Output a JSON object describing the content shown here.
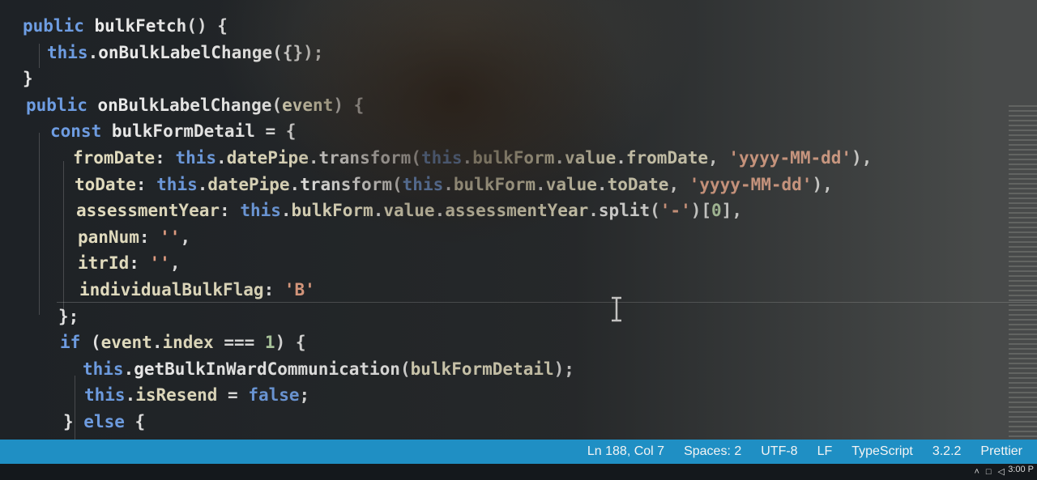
{
  "editor": {
    "lines": [
      [
        {
          "c": "kw",
          "t": "public "
        },
        {
          "c": "fn",
          "t": "bulkFetch"
        },
        {
          "c": "pun",
          "t": "() {"
        }
      ],
      [
        {
          "c": "kw",
          "t": "this"
        },
        {
          "c": "pun",
          "t": "."
        },
        {
          "c": "fn",
          "t": "onBulkLabelChange"
        },
        {
          "c": "pun",
          "t": "({});"
        }
      ],
      [
        {
          "c": "pun",
          "t": "}"
        }
      ],
      [
        {
          "c": "kw",
          "t": "public "
        },
        {
          "c": "fn",
          "t": "onBulkLabelChange"
        },
        {
          "c": "pun",
          "t": "("
        },
        {
          "c": "prop",
          "t": "event"
        },
        {
          "c": "pun",
          "t": ") {"
        }
      ],
      [
        {
          "c": "kw",
          "t": "const "
        },
        {
          "c": "fn",
          "t": "bulkFormDetail"
        },
        {
          "c": "pun",
          "t": " = {"
        }
      ],
      [
        {
          "c": "prop",
          "t": "fromDate"
        },
        {
          "c": "pun",
          "t": ": "
        },
        {
          "c": "kw",
          "t": "this"
        },
        {
          "c": "pun",
          "t": "."
        },
        {
          "c": "prop",
          "t": "datePipe"
        },
        {
          "c": "pun",
          "t": "."
        },
        {
          "c": "fn",
          "t": "transform"
        },
        {
          "c": "pun",
          "t": "("
        },
        {
          "c": "kw",
          "t": "this"
        },
        {
          "c": "pun",
          "t": "."
        },
        {
          "c": "prop",
          "t": "bulkForm"
        },
        {
          "c": "pun",
          "t": "."
        },
        {
          "c": "prop",
          "t": "value"
        },
        {
          "c": "pun",
          "t": "."
        },
        {
          "c": "prop",
          "t": "fromDate"
        },
        {
          "c": "pun",
          "t": ", "
        },
        {
          "c": "str",
          "t": "'yyyy-MM-dd'"
        },
        {
          "c": "pun",
          "t": "),"
        }
      ],
      [
        {
          "c": "prop",
          "t": "toDate"
        },
        {
          "c": "pun",
          "t": ": "
        },
        {
          "c": "kw",
          "t": "this"
        },
        {
          "c": "pun",
          "t": "."
        },
        {
          "c": "prop",
          "t": "datePipe"
        },
        {
          "c": "pun",
          "t": "."
        },
        {
          "c": "fn",
          "t": "transform"
        },
        {
          "c": "pun",
          "t": "("
        },
        {
          "c": "kw",
          "t": "this"
        },
        {
          "c": "pun",
          "t": "."
        },
        {
          "c": "prop",
          "t": "bulkForm"
        },
        {
          "c": "pun",
          "t": "."
        },
        {
          "c": "prop",
          "t": "value"
        },
        {
          "c": "pun",
          "t": "."
        },
        {
          "c": "prop",
          "t": "toDate"
        },
        {
          "c": "pun",
          "t": ", "
        },
        {
          "c": "str",
          "t": "'yyyy-MM-dd'"
        },
        {
          "c": "pun",
          "t": "),"
        }
      ],
      [
        {
          "c": "prop",
          "t": "assessmentYear"
        },
        {
          "c": "pun",
          "t": ": "
        },
        {
          "c": "kw",
          "t": "this"
        },
        {
          "c": "pun",
          "t": "."
        },
        {
          "c": "prop",
          "t": "bulkForm"
        },
        {
          "c": "pun",
          "t": "."
        },
        {
          "c": "prop",
          "t": "value"
        },
        {
          "c": "pun",
          "t": "."
        },
        {
          "c": "prop",
          "t": "assessmentYear"
        },
        {
          "c": "pun",
          "t": "."
        },
        {
          "c": "fn",
          "t": "split"
        },
        {
          "c": "pun",
          "t": "("
        },
        {
          "c": "str",
          "t": "'-'"
        },
        {
          "c": "pun",
          "t": ")["
        },
        {
          "c": "num",
          "t": "0"
        },
        {
          "c": "pun",
          "t": "],"
        }
      ],
      [
        {
          "c": "prop",
          "t": "panNum"
        },
        {
          "c": "pun",
          "t": ": "
        },
        {
          "c": "str",
          "t": "''"
        },
        {
          "c": "pun",
          "t": ","
        }
      ],
      [
        {
          "c": "prop",
          "t": "itrId"
        },
        {
          "c": "pun",
          "t": ": "
        },
        {
          "c": "str",
          "t": "''"
        },
        {
          "c": "pun",
          "t": ","
        }
      ],
      [
        {
          "c": "prop",
          "t": "individualBulkFlag"
        },
        {
          "c": "pun",
          "t": ": "
        },
        {
          "c": "str",
          "t": "'B'"
        }
      ],
      [
        {
          "c": "pun",
          "t": "};"
        }
      ],
      [
        {
          "c": "kw",
          "t": "if "
        },
        {
          "c": "pun",
          "t": "("
        },
        {
          "c": "prop",
          "t": "event"
        },
        {
          "c": "pun",
          "t": "."
        },
        {
          "c": "prop",
          "t": "index"
        },
        {
          "c": "pun",
          "t": " === "
        },
        {
          "c": "num",
          "t": "1"
        },
        {
          "c": "pun",
          "t": ") {"
        }
      ],
      [
        {
          "c": "kw",
          "t": "this"
        },
        {
          "c": "pun",
          "t": "."
        },
        {
          "c": "fn",
          "t": "getBulkInWardCommunication"
        },
        {
          "c": "pun",
          "t": "("
        },
        {
          "c": "prop",
          "t": "bulkFormDetail"
        },
        {
          "c": "pun",
          "t": ");"
        }
      ],
      [
        {
          "c": "kw",
          "t": "this"
        },
        {
          "c": "pun",
          "t": "."
        },
        {
          "c": "prop",
          "t": "isResend"
        },
        {
          "c": "pun",
          "t": " = "
        },
        {
          "c": "kw",
          "t": "false"
        },
        {
          "c": "pun",
          "t": ";"
        }
      ],
      [
        {
          "c": "pun",
          "t": "} "
        },
        {
          "c": "kw",
          "t": "else "
        },
        {
          "c": "pun",
          "t": "{"
        }
      ]
    ]
  },
  "status": {
    "position": "Ln 188, Col 7",
    "spaces": "Spaces: 2",
    "encoding": "UTF-8",
    "eol": "LF",
    "language": "TypeScript",
    "version": "3.2.2",
    "formatter": "Prettier"
  },
  "taskbar": {
    "time": "3:00 P"
  },
  "colors": {
    "statusbar": "#1f8fc4",
    "keyword": "#6f9fe6",
    "string": "#e9a285"
  }
}
